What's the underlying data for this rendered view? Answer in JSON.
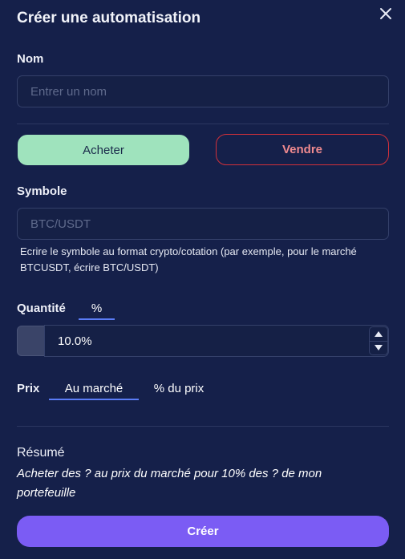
{
  "dialog": {
    "title": "Créer une automatisation"
  },
  "name_field": {
    "label": "Nom",
    "placeholder": "Entrer un nom",
    "value": ""
  },
  "side": {
    "buy_label": "Acheter",
    "sell_label": "Vendre",
    "selected": "buy"
  },
  "symbol_field": {
    "label": "Symbole",
    "placeholder": "BTC/USDT",
    "value": "",
    "help": "Ecrire le symbole au format crypto/cotation (par exemple, pour le marché BTCUSDT, écrire BTC/USDT)"
  },
  "quantity": {
    "label": "Quantité",
    "unit_tab": "%",
    "value": "10.0%"
  },
  "price": {
    "label": "Prix",
    "tabs": [
      "Au marché",
      "% du prix"
    ],
    "selected": "Au marché"
  },
  "summary": {
    "title": "Résumé",
    "text": "Acheter des ? au prix du marché pour 10% des ? de mon portefeuille"
  },
  "create_button": {
    "label": "Créer"
  },
  "colors": {
    "background": "#15204a",
    "buy": "#9fe3bd",
    "sell_border": "#d2303a",
    "sell_text": "#f08a8f",
    "accent": "#5b7cf6",
    "primary": "#7b5cf4"
  },
  "icons": {
    "close": "close-icon",
    "step_up": "triangle-up-icon",
    "step_down": "triangle-down-icon"
  }
}
